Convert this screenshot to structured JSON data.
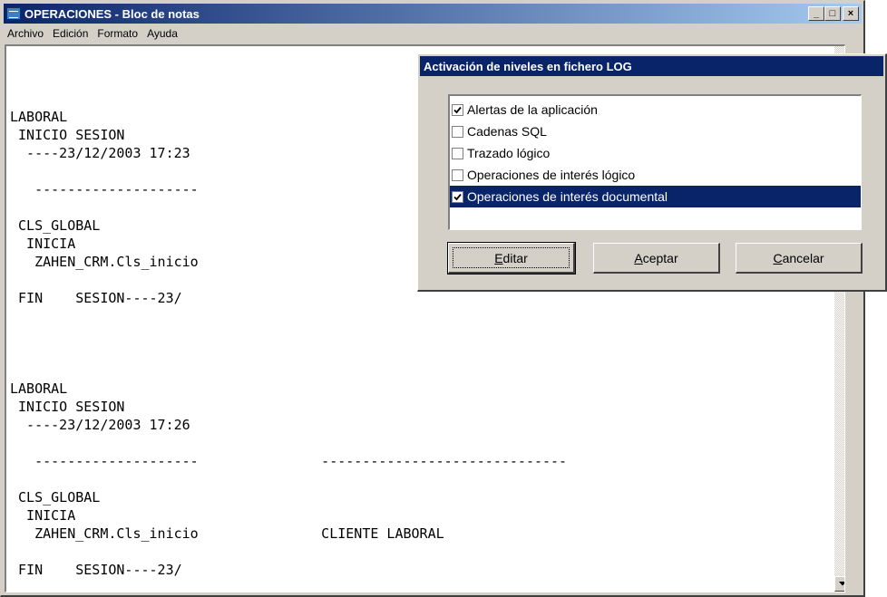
{
  "notepad": {
    "title": "OPERACIONES - Bloc de notas",
    "caption_buttons": {
      "minimize": "_",
      "maximize": "□",
      "close": "×"
    },
    "menu": [
      "Archivo",
      "Edición",
      "Formato",
      "Ayuda"
    ],
    "lines": [
      "",
      "LABORAL",
      " INICIO SESION",
      "  ----23/12/2003 17:23",
      "",
      "   --------------------",
      "",
      " CLS_GLOBAL",
      "  INICIA",
      "   ZAHEN_CRM.Cls_inicio",
      "",
      " FIN    SESION----23/",
      "",
      "",
      "",
      "",
      "LABORAL",
      " INICIO SESION",
      "  ----23/12/2003 17:26",
      "",
      "   --------------------               ------------------------------",
      "",
      " CLS_GLOBAL",
      "  INICIA",
      "   ZAHEN_CRM.Cls_inicio               CLIENTE LABORAL",
      "",
      " FIN    SESION----23/"
    ]
  },
  "dialog": {
    "title": "Activación de niveles en fichero LOG",
    "options": [
      {
        "label": "Alertas de la aplicación",
        "checked": true,
        "selected": false
      },
      {
        "label": "Cadenas SQL",
        "checked": false,
        "selected": false
      },
      {
        "label": "Trazado lógico",
        "checked": false,
        "selected": false
      },
      {
        "label": "Operaciones de interés lógico",
        "checked": false,
        "selected": false
      },
      {
        "label": "Operaciones de interés documental",
        "checked": true,
        "selected": true
      }
    ],
    "buttons": {
      "edit": {
        "mnemonic": "E",
        "rest": "ditar"
      },
      "accept": {
        "mnemonic": "A",
        "rest": "ceptar"
      },
      "cancel": {
        "mnemonic": "C",
        "rest": "ancelar"
      }
    }
  },
  "colors": {
    "titlebar_active": "#0a246a",
    "face": "#d4d0c8",
    "selection": "#0a246a"
  }
}
